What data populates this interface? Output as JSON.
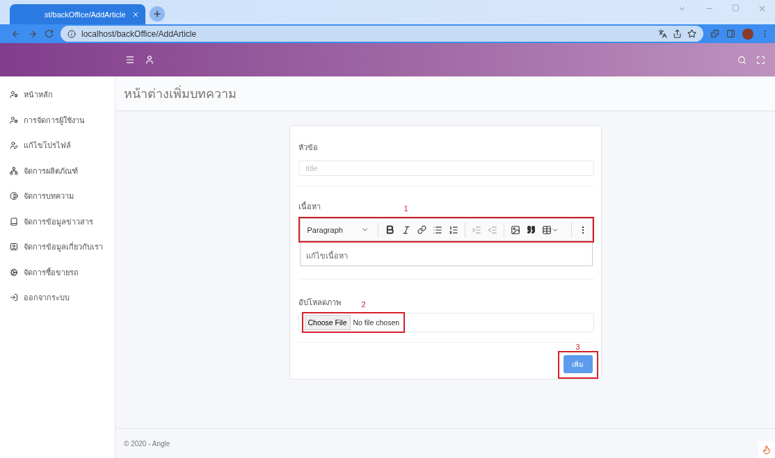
{
  "browser": {
    "tab_title": "st/backOffice/AddArticle",
    "address": "localhost/backOffice/AddArticle"
  },
  "sidebar": {
    "items": [
      {
        "label": "หน้าหลัก"
      },
      {
        "label": "การจัดการผู้ใช้งาน"
      },
      {
        "label": "แก้ไขโปรไฟล์"
      },
      {
        "label": "จัดการผลิตภัณฑ์"
      },
      {
        "label": "จัดการบทความ"
      },
      {
        "label": "จัดการข้อมูลข่าวสาร"
      },
      {
        "label": "จัดการข้อมูลเกี่ยวกับเรา"
      },
      {
        "label": "จัดการซื้อขายรถ"
      },
      {
        "label": "ออกจากระบบ"
      }
    ]
  },
  "page_title": "หน้าต่างเพิ่มบทความ",
  "form": {
    "title_label": "หัวข้อ",
    "title_placeholder": "title",
    "content_label": "เนื้อหา",
    "heading_style": "Paragraph",
    "content_text": "แก้ไขเนื้อหา",
    "upload_label": "อัปโหลดภาพ",
    "file_button": "Choose File",
    "file_status": "No file chosen",
    "submit": "เพิ่ม"
  },
  "annotations": [
    "1",
    "2",
    "3"
  ],
  "footer": "© 2020 - Angle"
}
